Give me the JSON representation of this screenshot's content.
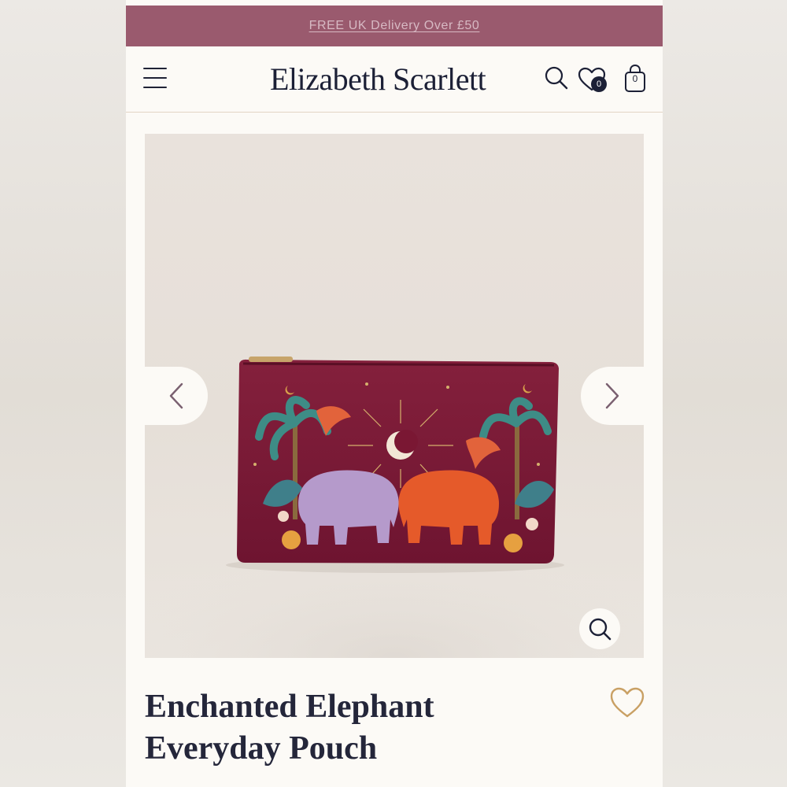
{
  "promo": {
    "text": "FREE UK Delivery Over £50"
  },
  "header": {
    "brand": "Elizabeth Scarlett",
    "icons": {
      "menu": "hamburger-menu-icon",
      "search": "search-icon",
      "wishlist": "heart-icon",
      "bag": "shopping-bag-icon"
    },
    "wishlist_count": "0",
    "bag_count": "0"
  },
  "gallery": {
    "image_description_icon": "product-photo",
    "prev_icon": "chevron-left-icon",
    "next_icon": "chevron-right-icon",
    "zoom_icon": "zoom-icon"
  },
  "product": {
    "title_line1": "Enchanted Elephant",
    "title_line2": "Everyday Pouch",
    "favourite_icon": "heart-outline-icon"
  },
  "colors": {
    "promo_bg": "#9a5a6e",
    "brand_text": "#1c2036",
    "page_bg": "#fcfaf6",
    "pouch": "#7a1733",
    "accent_gold": "#c9a064"
  }
}
